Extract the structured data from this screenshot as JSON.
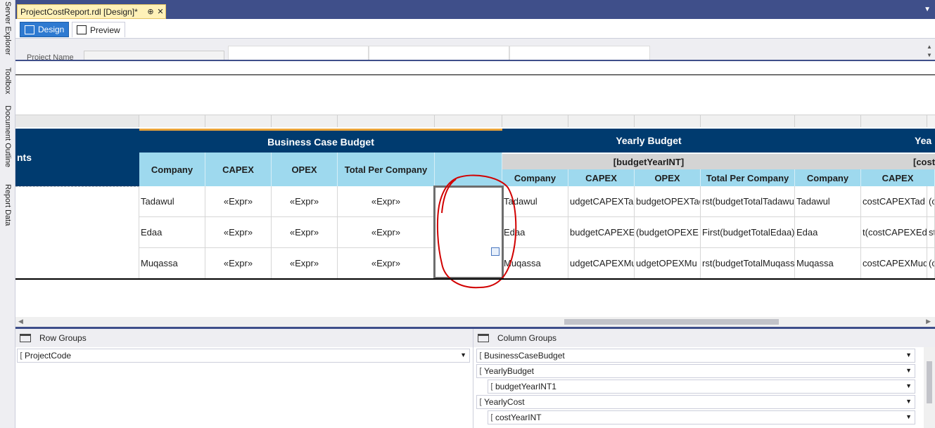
{
  "side_tabs": [
    "Server Explorer",
    "Toolbox",
    "Document Outline",
    "Report Data"
  ],
  "document_tab": {
    "title": "ProjectCostReport.rdl [Design]*",
    "pin": "⊕",
    "close": "✕"
  },
  "modes": {
    "design": "Design",
    "preview": "Preview"
  },
  "parameter": {
    "label": "Project Name"
  },
  "tablix": {
    "row_header_partial": "nts",
    "business_case_title": "Business Case Budget",
    "yearly_budget_title": "Yearly Budget",
    "yearly_cost_title_partial": "Yea",
    "budget_year_expr": "[budgetYearINT]",
    "cost_year_expr_partial": "[cost",
    "bc_columns": [
      "Company",
      "CAPEX",
      "OPEX",
      "Total Per Company"
    ],
    "yb_columns": [
      "Company",
      "CAPEX",
      "OPEX",
      "Total Per Company"
    ],
    "yc_columns": [
      "Company",
      "CAPEX"
    ],
    "rows": [
      {
        "company": "Tadawul",
        "capex": "«Expr»",
        "opex": "«Expr»",
        "total": "«Expr»",
        "yb_company": "Tadawul",
        "yb_capex": "udgetCAPEXTa",
        "yb_opex": "budgetOPEXTac",
        "yb_total": "rst(budgetTotalTadawu",
        "yc_company": "Tadawul",
        "yc_capex": "costCAPEXTad",
        "yc_extra": "(c"
      },
      {
        "company": "Edaa",
        "capex": "«Expr»",
        "opex": "«Expr»",
        "total": "«Expr»",
        "yb_company": "Edaa",
        "yb_capex": "budgetCAPEXE",
        "yb_opex": "(budgetOPEXE",
        "yb_total": "First(budgetTotalEdaa)",
        "yc_company": "Edaa",
        "yc_capex": "t(costCAPEXEd",
        "yc_extra": "st"
      },
      {
        "company": "Muqassa",
        "capex": "«Expr»",
        "opex": "«Expr»",
        "total": "«Expr»",
        "yb_company": "Muqassa",
        "yb_capex": "udgetCAPEXMu",
        "yb_opex": "udgetOPEXMu",
        "yb_total": "rst(budgetTotalMuqass",
        "yc_company": "Muqassa",
        "yc_capex": "costCAPEXMuq",
        "yc_extra": "(c"
      }
    ]
  },
  "row_groups": {
    "title": "Row Groups",
    "items": [
      "ProjectCode"
    ]
  },
  "column_groups": {
    "title": "Column Groups",
    "items": [
      "BusinessCaseBudget",
      "YearlyBudget",
      "budgetYearINT1",
      "YearlyCost",
      "costYearINT"
    ]
  },
  "colors": {
    "header_dark": "#003b6f",
    "header_light": "#9ed9ee",
    "tab_strip": "#3f4f8a",
    "design_active": "#2e7ad1",
    "annotation": "#d10000"
  },
  "icons": [
    "pin-icon",
    "close-icon",
    "design-icon",
    "preview-icon",
    "row-groups-icon",
    "column-groups-icon",
    "chevron-down-icon",
    "textbox-icon"
  ]
}
